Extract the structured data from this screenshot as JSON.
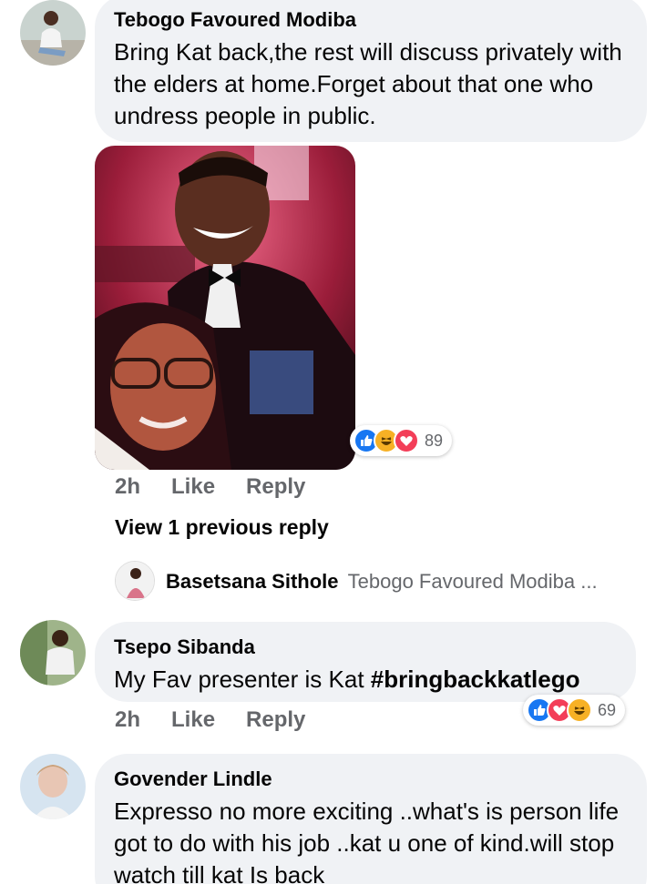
{
  "comments": [
    {
      "author": "Tebogo Favoured Modiba",
      "text": "Bring Kat back,the rest will discuss privately with the elders at home.Forget about that one who undress people in public.",
      "time": "2h",
      "like_label": "Like",
      "reply_label": "Reply",
      "reactions": [
        "like",
        "haha",
        "love"
      ],
      "reaction_count": "89"
    },
    {
      "author": "Tsepo Sibanda",
      "text_plain": "My Fav presenter is Kat ",
      "hashtag": "#bringbackkatlego",
      "time": "2h",
      "like_label": "Like",
      "reply_label": "Reply",
      "reactions": [
        "like",
        "love",
        "haha"
      ],
      "reaction_count": "69"
    },
    {
      "author": "Govender Lindle",
      "text": "Expresso no more exciting ..what's is person life got to do with his job ..kat u one of kind.will stop watch till kat Is back"
    }
  ],
  "replies": {
    "view_previous_label": "View 1 previous reply",
    "preview_author": "Basetsana Sithole",
    "preview_text": "Tebogo Favoured Modiba ..."
  },
  "colors": {
    "bubble": "#f0f2f5",
    "meta_text": "#65676b",
    "like": "#1877f2",
    "love": "#f33e58",
    "haha": "#f7b125"
  }
}
